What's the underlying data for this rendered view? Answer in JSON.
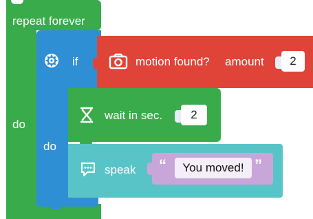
{
  "repeat_block": {
    "label": "repeat forever",
    "do_label": "do",
    "color": "#3aab4a"
  },
  "if_block": {
    "label": "if",
    "do_label": "do",
    "color": "#2f8fd4",
    "icon": "gear-icon"
  },
  "motion_block": {
    "label": "motion found?",
    "amount_label": "amount",
    "amount_value": "2",
    "color": "#e04438",
    "icon": "camera-icon"
  },
  "wait_block": {
    "label": "wait in sec.",
    "value": "2",
    "color": "#3aab4a",
    "icon": "hourglass-icon"
  },
  "speak_block": {
    "label": "speak",
    "open_quote": "“",
    "close_quote": "”",
    "text": "You moved!",
    "color": "#58c4c8",
    "icon": "speech-bubble-icon"
  }
}
